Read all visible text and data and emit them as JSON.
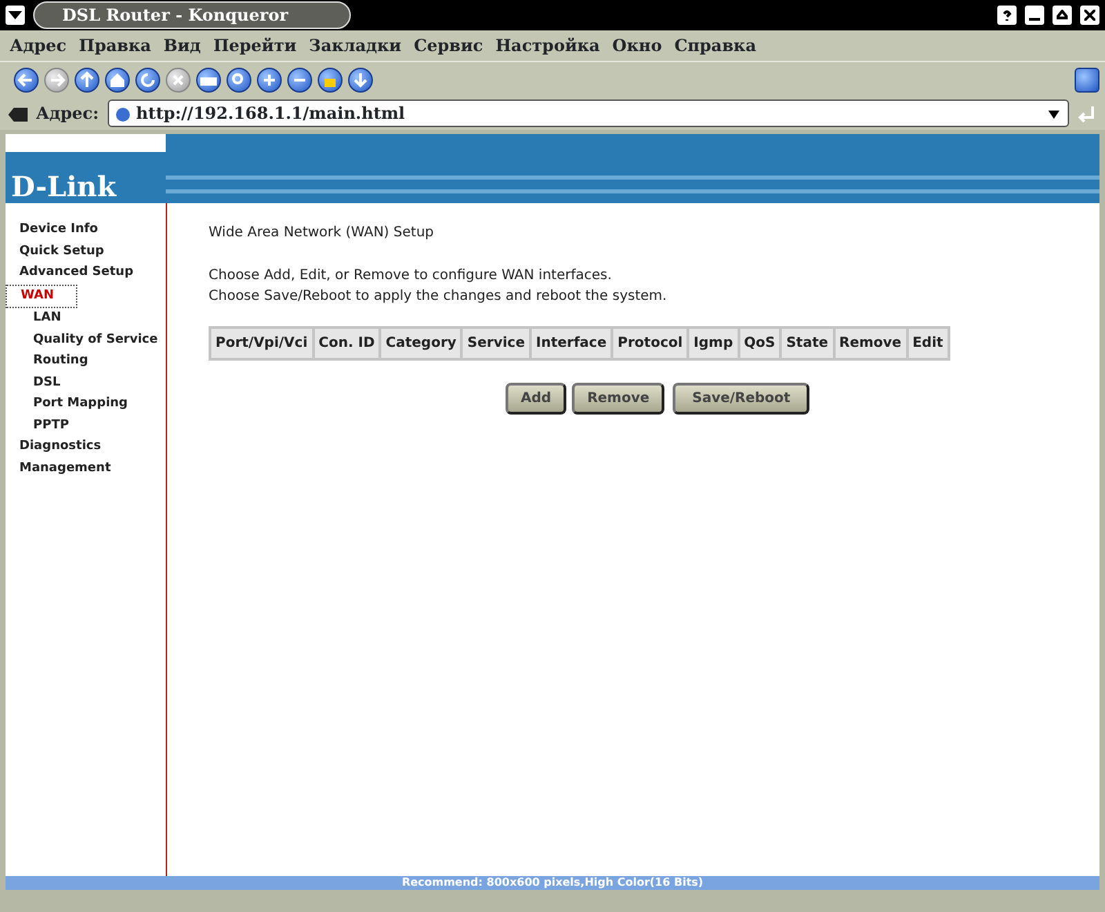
{
  "window": {
    "title": "DSL Router - Konqueror"
  },
  "menu": [
    "Адрес",
    "Правка",
    "Вид",
    "Перейти",
    "Закладки",
    "Сервис",
    "Настройка",
    "Окно",
    "Справка"
  ],
  "toolbar": [
    {
      "kind": "back",
      "disabled": false
    },
    {
      "kind": "forward",
      "disabled": true
    },
    {
      "kind": "up",
      "disabled": false
    },
    {
      "kind": "home",
      "disabled": false
    },
    {
      "kind": "reload",
      "disabled": false
    },
    {
      "kind": "stop",
      "disabled": true
    },
    {
      "kind": "print",
      "disabled": false
    },
    {
      "kind": "find",
      "disabled": false
    },
    {
      "kind": "zoomin",
      "disabled": false
    },
    {
      "kind": "zoomout",
      "disabled": false
    },
    {
      "kind": "lock",
      "disabled": false
    },
    {
      "kind": "download",
      "disabled": false
    }
  ],
  "address_bar": {
    "label": "Адрес:",
    "value": "http://192.168.1.1/main.html"
  },
  "logo": "D-Link",
  "sidebar": {
    "items": [
      {
        "label": "Device Info",
        "selected": false
      },
      {
        "label": "Quick Setup",
        "selected": false
      },
      {
        "label": "Advanced Setup",
        "selected": false,
        "children": [
          {
            "label": "WAN",
            "selected": true
          },
          {
            "label": "LAN",
            "selected": false
          },
          {
            "label": "Quality of Service",
            "selected": false
          },
          {
            "label": "Routing",
            "selected": false
          },
          {
            "label": "DSL",
            "selected": false
          },
          {
            "label": "Port Mapping",
            "selected": false
          },
          {
            "label": "PPTP",
            "selected": false
          }
        ]
      },
      {
        "label": "Diagnostics",
        "selected": false
      },
      {
        "label": "Management",
        "selected": false
      }
    ]
  },
  "content": {
    "heading": "Wide Area Network (WAN) Setup",
    "instructions": [
      "Choose Add, Edit, or Remove to configure WAN interfaces.",
      "Choose Save/Reboot to apply the changes and reboot the system."
    ],
    "table": {
      "columns": [
        "Port/Vpi/Vci",
        "Con. ID",
        "Category",
        "Service",
        "Interface",
        "Protocol",
        "Igmp",
        "QoS",
        "State",
        "Remove",
        "Edit"
      ]
    },
    "buttons": [
      "Add",
      "Remove",
      "Save/Reboot"
    ]
  },
  "footer": "Recommend: 800x600 pixels,High Color(16 Bits)"
}
